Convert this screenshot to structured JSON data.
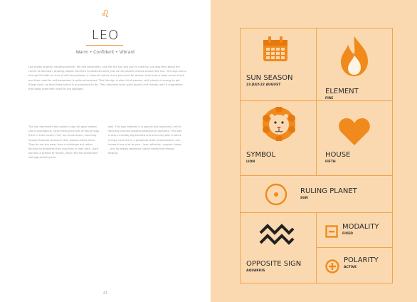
{
  "left_page": {
    "glyph": "♌",
    "title": "LEO",
    "traits": "Warm • Confident • Vibrant",
    "paragraph_1": "Leo shines brightly, exuding warmth, life and generosity, just like the Sun this sign is ruled by. Leo also likes being the centre of attention, drawing people into their sunbeamed orbit, just as the planets revolve around the Sun. This sign works through life with an aura of self-assuredness, a cheerful nature and a penchant for drama. Leos have a deep sense of self and their need for self-expression is quite entrenched. This fire sign is also full of passion, with plenty of energy to get things done, as their fixed nature is accustomed to do. They also tend to be quite playful and cheeky, with a magnetism that helps feed their need for the spotlight.",
    "column_a": "The lion represents this zodiac's sign for good reason. Leo is courageous, never letting the fear of failure stop them in their tracks. They are brave doers, marching forward towards wherever their passion takes them. They do not shy away from a challenge but rather pounce on problems they may face in their path. Lions are also a symbol of royalty, which fits the sometimes self-aggrandising Leo",
    "column_b": "well. This sign believes it is special and important, and is naturally inclined towards positions of authority. This sign is also incredibly big-hearted and brimming with creative energy. Leos live in a perpetual state of abundance. Leo knows it has a lot to give – love, affection, support, ideas – and its deeply generous nature keeps that energy flowing.",
    "page_number": "41"
  },
  "right_page": {
    "cells": {
      "sun_season": {
        "label": "SUN SEASON",
        "value": "23 JULY-22 AUGUST",
        "icon": "calendar-icon"
      },
      "element": {
        "label": "ELEMENT",
        "value": "FIRE",
        "icon": "flame-icon"
      },
      "symbol": {
        "label": "SYMBOL",
        "value": "LION",
        "icon": "lion-icon"
      },
      "house": {
        "label": "HOUSE",
        "value": "FIFTH",
        "icon": "heart-icon"
      },
      "ruling_planet": {
        "label": "RULING PLANET",
        "value": "SUN",
        "icon": "sun-symbol-icon"
      },
      "opposite_sign": {
        "label": "OPPOSITE SIGN",
        "value": "AQUARIUS",
        "icon": "aquarius-icon"
      },
      "modality": {
        "label": "MODALITY",
        "value": "FIXED",
        "icon": "square-minus-icon"
      },
      "polarity": {
        "label": "POLARITY",
        "value": "ACTIVE",
        "icon": "circle-plus-icon"
      }
    }
  },
  "colors": {
    "accent": "#f08a1c",
    "grid_line": "#f3a24a",
    "panel_bg": "#fbd9b0"
  }
}
